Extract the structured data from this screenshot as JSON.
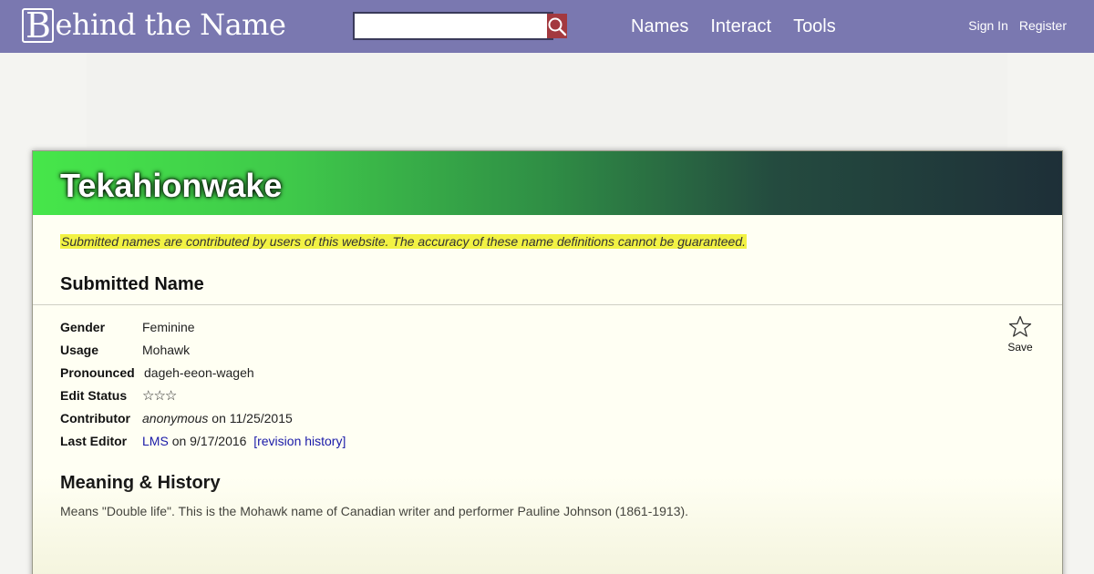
{
  "header": {
    "logo_initial": "B",
    "logo_rest": "ehind the Name",
    "search": {
      "value": "",
      "placeholder": ""
    },
    "nav": [
      "Names",
      "Interact",
      "Tools"
    ],
    "account": {
      "sign_in": "Sign In",
      "register": "Register"
    },
    "colors": {
      "bar": "#7a78b0",
      "search_button": "#a3393f"
    }
  },
  "name_page": {
    "title": "Tekahionwake",
    "disclaimer": "Submitted names are contributed by users of this website. The accuracy of these name definitions cannot be guaranteed.",
    "section_title": "Submitted Name",
    "info": {
      "gender": {
        "label": "Gender",
        "value": "Feminine"
      },
      "usage": {
        "label": "Usage",
        "value": "Mohawk"
      },
      "pronounced": {
        "label": "Pronounced",
        "value": "dageh-eeon-wageh"
      },
      "edit_status": {
        "label": "Edit Status",
        "stars": "☆☆☆",
        "rating": 0,
        "max": 3
      },
      "contributor": {
        "label": "Contributor",
        "user": "anonymous",
        "rest": "on 11/25/2015"
      },
      "last_editor": {
        "label": "Last Editor",
        "user": "LMS",
        "rest": "on 9/17/2016",
        "history_link": "[revision history]"
      }
    },
    "save_label": "Save",
    "meaning_title": "Meaning & History",
    "meaning_text": "Means \"Double life\". This is the Mohawk name of Canadian writer and performer Pauline Johnson (1861-1913)."
  }
}
